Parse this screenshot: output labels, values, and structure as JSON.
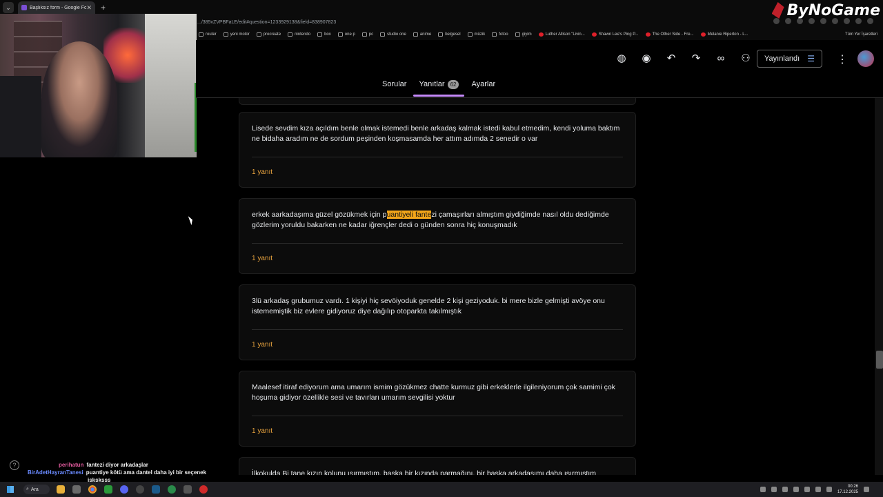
{
  "browser": {
    "tab_title": "Başlıksız form - Google Formlar",
    "url": ".../385vZVPBFaLE/edit#question=1233929138&field=838907823",
    "bookmarks": [
      "router",
      "yeni motor",
      "procreate",
      "nintendo",
      "box",
      "one p",
      "pc",
      "studio one",
      "anime",
      "belgesel",
      "müzik",
      "fotoo",
      "giyim",
      "Luther Allison \"Livin...",
      "Shawn Lee's Ping P...",
      "The Other Side - Fre...",
      "Melanie Riperton - L..."
    ],
    "bookmarks_all": "Tüm Yer İşaretleri"
  },
  "overlay": {
    "logo": "ByNoGame"
  },
  "form": {
    "publish_label": "Yayınlandı",
    "tabs": [
      {
        "label": "Sorular"
      },
      {
        "label": "Yanıtlar",
        "badge": "62"
      },
      {
        "label": "Ayarlar"
      }
    ],
    "responses": [
      {
        "text": "Lisede sevdim kıza açıldım benle olmak istemedi benle arkadaş kalmak istedi kabul etmedim, kendi yoluma baktım ne bidaha aradım ne de sordum peşinden koşmasamda her attım adımda 2 senedir o var",
        "count": "1 yanıt"
      },
      {
        "text_before": "erkek aarkadaşıma güzel gözükmek için p",
        "text_highlight": "uantiyeli fante",
        "text_after": "zi çamaşırları almıştım giydiğimde nasıl oldu dediğimde gözlerim yoruldu bakarken ne kadar iğrençler dedi o günden sonra hiç konuşmadık",
        "count": "1 yanıt"
      },
      {
        "text": "3lü arkadaş grubumuz vardı. 1 kişiyi hiç sevöiyoduk genelde 2 kişi geziyoduk. bi mere bizle gelmişti avöye onu istememiştik biz evlere gidiyoruz diye dağılıp otoparkta takılmıştık",
        "count": "1 yanıt"
      },
      {
        "text": "Maalesef itiraf ediyorum ama umarım ismim gözükmez chatte kurmuz gibi erkeklerle ilgileniyorum çok samimi çok hoşuma gidiyor özellikle sesi ve tavırları umarım sevgilisi yoktur",
        "count": "1 yanıt"
      },
      {
        "text": "İlkokulda Bi tane kızın kolunu ısırmıştım, başka bir kızında parmağını, bir başka arkadaşımı daha ısırmıştım"
      }
    ]
  },
  "chat": [
    {
      "user": "perihatun",
      "msg": "fantezi diyor arkadaşlar"
    },
    {
      "user": "BirAdetHayranTanesi",
      "msg": "puantiye kötü ama dantel daha iyi bir seçenek"
    },
    {
      "user": "",
      "msg": "jsksksss"
    }
  ],
  "taskbar": {
    "search": "Ara",
    "time": "00:26",
    "date": "17.12.2025"
  }
}
